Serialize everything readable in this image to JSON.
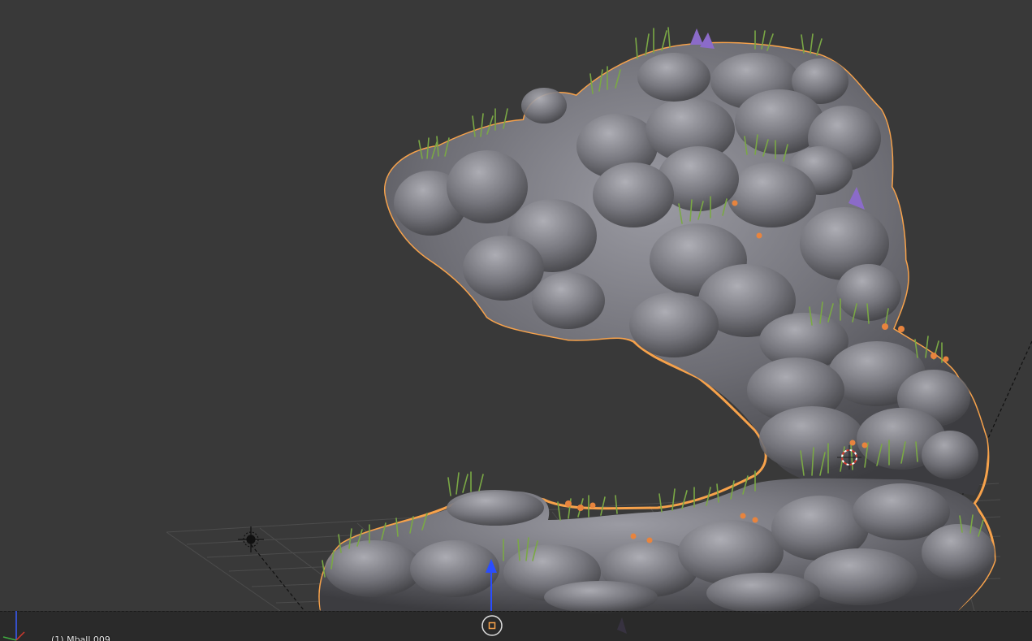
{
  "viewport": {
    "object_label": "(1) Mball.009",
    "background_color": "#393939",
    "selection_outline_color": "#f7a24b",
    "rock_color": "#7d7d85",
    "grass_color": "#6b9a3a"
  },
  "icons": {
    "axes": "view-axes-icon",
    "lamp": "lamp-icon",
    "cursor": "3d-cursor-icon",
    "origin": "object-origin-icon",
    "transform": "transform-manipulator-icon"
  }
}
